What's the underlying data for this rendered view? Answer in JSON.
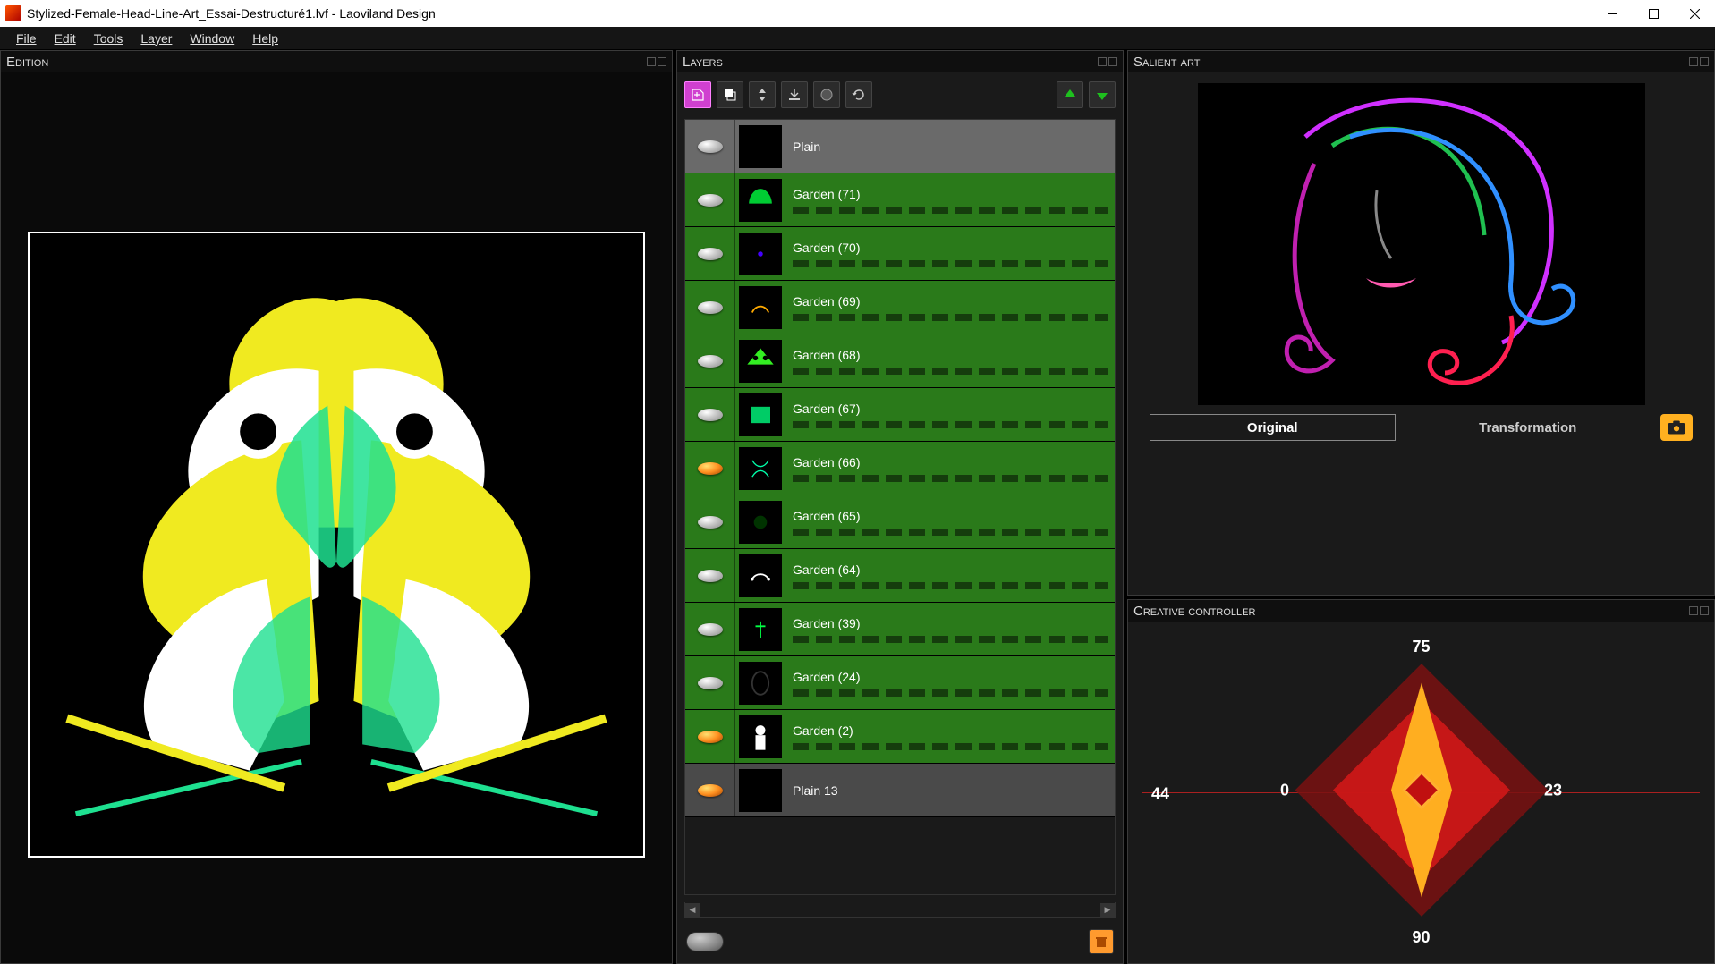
{
  "window": {
    "title": "Stylized-Female-Head-Line-Art_Essai-Destructuré1.lvf - Laoviland Design"
  },
  "menu": {
    "file": "File",
    "edit": "Edit",
    "tools": "Tools",
    "layer": "Layer",
    "window": "Window",
    "help": "Help"
  },
  "panels": {
    "edition": "Edition",
    "layers": "Layers",
    "salient": "Salient art",
    "creative": "Creative controller"
  },
  "layers": [
    {
      "name": "Plain",
      "type": "plain",
      "eye": "grey"
    },
    {
      "name": "Garden (71)",
      "type": "green",
      "eye": "grey"
    },
    {
      "name": "Garden (70)",
      "type": "green",
      "eye": "grey"
    },
    {
      "name": "Garden (69)",
      "type": "green",
      "eye": "grey"
    },
    {
      "name": "Garden (68)",
      "type": "green",
      "eye": "grey"
    },
    {
      "name": "Garden (67)",
      "type": "green",
      "eye": "grey"
    },
    {
      "name": "Garden (66)",
      "type": "green",
      "eye": "orange"
    },
    {
      "name": "Garden (65)",
      "type": "green",
      "eye": "grey"
    },
    {
      "name": "Garden (64)",
      "type": "green",
      "eye": "grey"
    },
    {
      "name": "Garden (39)",
      "type": "green",
      "eye": "grey"
    },
    {
      "name": "Garden (24)",
      "type": "green",
      "eye": "grey"
    },
    {
      "name": "Garden (2)",
      "type": "green",
      "eye": "orange"
    },
    {
      "name": "Plain 13",
      "type": "plain2",
      "eye": "orange"
    }
  ],
  "salient": {
    "tab_original": "Original",
    "tab_transformation": "Transformation"
  },
  "creative": {
    "top": "75",
    "left": "0",
    "right": "23",
    "farleft": "44",
    "bottom": "90"
  }
}
